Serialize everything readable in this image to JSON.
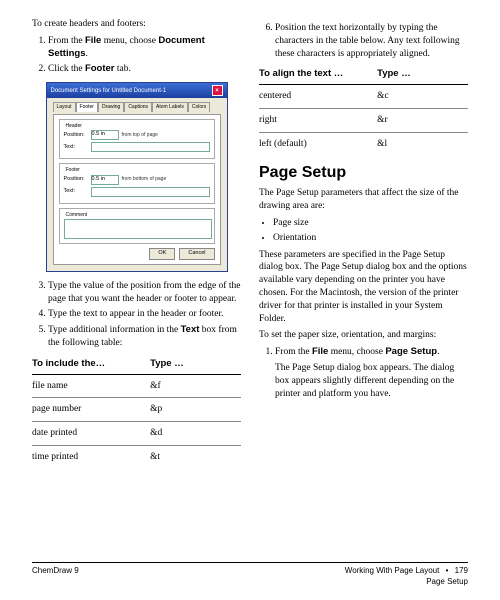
{
  "intro": "To create headers and footers:",
  "steps_a": [
    {
      "pre": "From the ",
      "b1": "File",
      "mid": " menu, choose ",
      "b2": "Document Settings",
      "post": "."
    },
    {
      "pre": "Click the ",
      "b1": "Footer",
      "mid": " tab.",
      "b2": "",
      "post": ""
    }
  ],
  "dialog": {
    "title": "Document Settings for Untitled Document-1",
    "tabs": [
      "Layout",
      "Footer",
      "Drawing",
      "Captions",
      "Atom Labels",
      "Colors"
    ],
    "header_group": "Header",
    "footer_group": "Footer",
    "position": "Position:",
    "header_pos": "0.5 in",
    "footer_pos": "0.5 in",
    "header_note": "from top of page",
    "footer_note": "from bottom of page",
    "text": "Text:",
    "comment": "Comment",
    "ok": "OK",
    "cancel": "Cancel"
  },
  "steps_b": [
    "Type the value of the position from the edge of the page that you want the header or footer to appear.",
    "Type the text to appear in the header or footer."
  ],
  "step5": {
    "pre": "Type additional information in the ",
    "b": "Text",
    "post": " box from the following table:"
  },
  "table1": {
    "h1": "To include the…",
    "h2": "Type …",
    "rows": [
      {
        "a": "file name",
        "b": "&f"
      },
      {
        "a": "page number",
        "b": "&p"
      },
      {
        "a": "date printed",
        "b": "&d"
      },
      {
        "a": "time printed",
        "b": "&t"
      }
    ]
  },
  "step6": "Position the text horizontally by typing the characters in the table below. Any text following these characters is appropriately aligned.",
  "table2": {
    "h1": "To align the text …",
    "h2": "Type …",
    "rows": [
      {
        "a": "centered",
        "b": "&c"
      },
      {
        "a": "right",
        "b": "&r"
      },
      {
        "a": "left (default)",
        "b": "&l"
      }
    ]
  },
  "section": "Page Setup",
  "ps_intro": "The Page Setup parameters that affect the size of the drawing area are:",
  "ps_bullets": [
    "Page size",
    "Orientation"
  ],
  "ps_para": "These parameters are specified in the Page Setup dialog box. The Page Setup dialog box and the options available vary depending on the printer you have chosen. For the Macintosh, the version of the printer driver for that printer is installed in your System Folder.",
  "ps_para2": "To set the paper size, orientation, and margins:",
  "ps_step1": {
    "pre": "From the ",
    "b1": "File",
    "mid": " menu, choose ",
    "b2": "Page Setup",
    "post": "."
  },
  "ps_result": "The Page Setup dialog box appears. The dialog box appears slightly different depending on the printer and platform you have.",
  "footer": {
    "left": "ChemDraw 9",
    "right1": "Working With Page Layout",
    "dot": "•",
    "page": "179",
    "right2": "Page Setup"
  }
}
